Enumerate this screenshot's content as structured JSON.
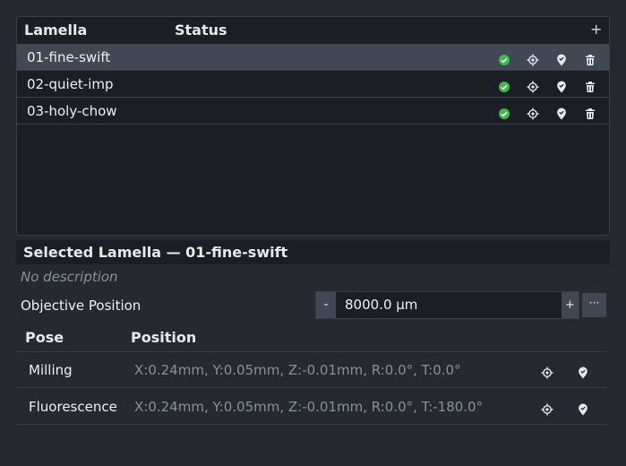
{
  "lamella_table": {
    "col_lamella": "Lamella",
    "col_status": "Status",
    "add_label": "+",
    "rows": [
      {
        "name": "01-fine-swift",
        "selected": true
      },
      {
        "name": "02-quiet-imp",
        "selected": false
      },
      {
        "name": "03-holy-chow",
        "selected": false
      }
    ],
    "row_icons": [
      "check-circle-icon",
      "crosshair-icon",
      "map-pin-icon",
      "trash-icon"
    ]
  },
  "selected": {
    "title": "Selected Lamella — 01-fine-swift",
    "description": "No description",
    "objective_label": "Objective Position",
    "objective_value": "8000.0 µm",
    "minus_label": "-",
    "plus_label": "+",
    "more_label": "···"
  },
  "poses": {
    "col_pose": "Pose",
    "col_position": "Position",
    "rows": [
      {
        "pose": "Milling",
        "position": "X:0.24mm, Y:0.05mm, Z:-0.01mm, R:0.0°, T:0.0°"
      },
      {
        "pose": "Fluorescence",
        "position": "X:0.24mm, Y:0.05mm, Z:-0.01mm, R:0.0°, T:-180.0°"
      }
    ]
  },
  "colors": {
    "background": "#262930",
    "panel": "#1b1e24",
    "selected_row": "#414854",
    "status_green": "#3db94f",
    "muted_text": "#8b8f97"
  }
}
